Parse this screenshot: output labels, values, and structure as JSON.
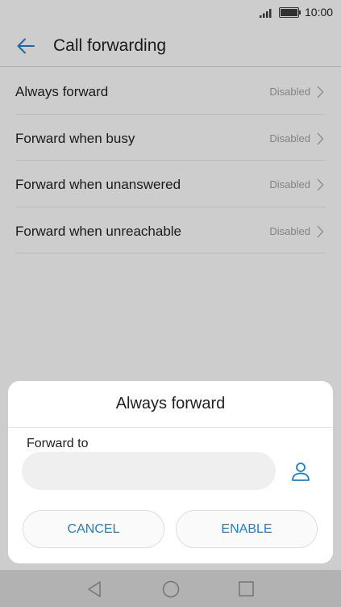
{
  "status_bar": {
    "time": "10:00",
    "signal_icon": "signal-bars-icon",
    "battery_icon": "battery-icon"
  },
  "header": {
    "title": "Call forwarding",
    "back_icon": "arrow-left-icon"
  },
  "list": {
    "items": [
      {
        "label": "Always forward",
        "status": "Disabled"
      },
      {
        "label": "Forward when busy",
        "status": "Disabled"
      },
      {
        "label": "Forward when unanswered",
        "status": "Disabled"
      },
      {
        "label": "Forward when unreachable",
        "status": "Disabled"
      }
    ]
  },
  "dialog": {
    "title": "Always forward",
    "field_label": "Forward to",
    "field_value": "",
    "contact_icon": "person-icon",
    "cancel_label": "CANCEL",
    "enable_label": "ENABLE"
  },
  "nav_bar": {
    "icons": [
      "nav-back-icon",
      "nav-home-icon",
      "nav-recents-icon"
    ]
  },
  "colors": {
    "accent": "#1a7fd1",
    "status_text": "#9a9a9a",
    "background": "#f1f1f1"
  }
}
